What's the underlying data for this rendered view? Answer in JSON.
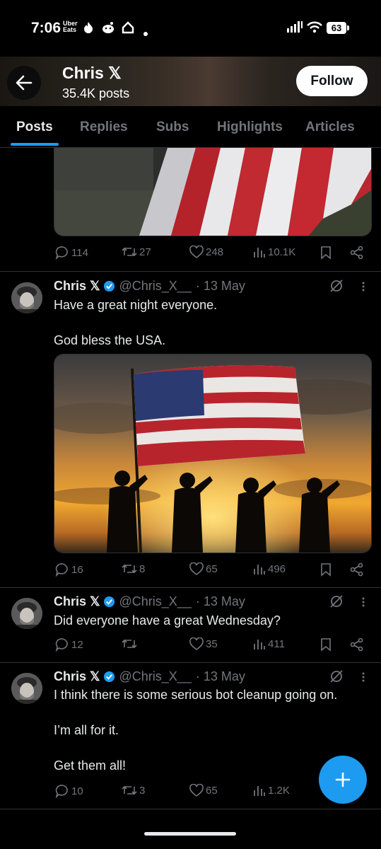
{
  "status_bar": {
    "time": "7:06",
    "uber_eats": "Uber Eats",
    "battery": "63"
  },
  "header": {
    "name": "Chris 𝕏",
    "posts_count": "35.4K posts",
    "follow_label": "Follow"
  },
  "tabs": [
    {
      "label": "Posts"
    },
    {
      "label": "Replies"
    },
    {
      "label": "Subs"
    },
    {
      "label": "Highlights"
    },
    {
      "label": "Articles"
    }
  ],
  "first_post_metrics": {
    "replies": "114",
    "reposts": "27",
    "likes": "248",
    "views": "10.1K"
  },
  "tweets": [
    {
      "name": "Chris 𝕏",
      "handle": "@Chris_X__",
      "date": "· 13 May",
      "lines": [
        "Have a great night everyone.",
        "",
        "God bless the USA."
      ],
      "replies": "16",
      "reposts": "8",
      "likes": "65",
      "views": "496"
    },
    {
      "name": "Chris 𝕏",
      "handle": "@Chris_X__",
      "date": "· 13 May",
      "lines": [
        "Did everyone have a great Wednesday?"
      ],
      "replies": "12",
      "reposts": "",
      "likes": "35",
      "views": "411"
    },
    {
      "name": "Chris 𝕏",
      "handle": "@Chris_X__",
      "date": "· 13 May",
      "lines": [
        "I think there is some serious bot cleanup going on.",
        "",
        "I’m all for it.",
        "",
        "Get them all!"
      ],
      "replies": "10",
      "reposts": "3",
      "likes": "65",
      "views": "1.2K"
    }
  ],
  "colors": {
    "accent": "#1d9bf0",
    "muted": "#71767b",
    "background": "#000000"
  }
}
